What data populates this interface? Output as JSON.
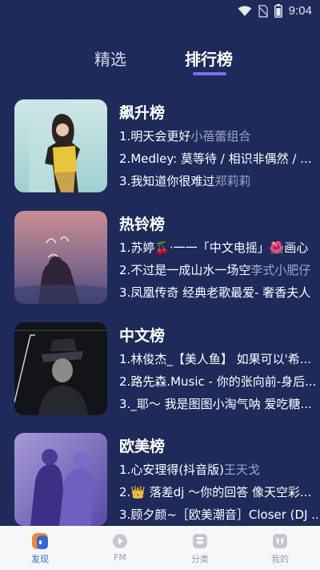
{
  "status_bar": {
    "time": "9:04"
  },
  "tabs": [
    {
      "label": "精选",
      "active": false
    },
    {
      "label": "排行榜",
      "active": true
    }
  ],
  "charts": [
    {
      "title": "飙升榜",
      "tracks": [
        {
          "num": "1.",
          "song": "明天会更好",
          "artist": "小蓓蕾组合"
        },
        {
          "num": "2.",
          "song": "Medley: 莫等待 / 相识非偶然 / ...",
          "artist": ""
        },
        {
          "num": "3.",
          "song": "我知道你很难过",
          "artist": "郑莉莉"
        }
      ]
    },
    {
      "title": "热铃榜",
      "tracks": [
        {
          "num": "1.",
          "song": "苏婷🍒·一一「中文电摇」🌺画心",
          "artist": ""
        },
        {
          "num": "2.",
          "song": "不过是一成山水一场空",
          "artist": "李式小肥仔"
        },
        {
          "num": "3.",
          "song": "凤凰传奇 经典老歌最爱- 奢香夫人",
          "artist": ""
        }
      ]
    },
    {
      "title": "中文榜",
      "tracks": [
        {
          "num": "1.",
          "song": "林俊杰_【美人鱼】 如果可以'希...",
          "artist": ""
        },
        {
          "num": "2.",
          "song": "路先森.Music - 你的张向前-身后...",
          "artist": ""
        },
        {
          "num": "3.",
          "song": "_耶～ 我是图图小淘气呐 爱吃糖...",
          "artist": ""
        }
      ]
    },
    {
      "title": "欧美榜",
      "tracks": [
        {
          "num": "1.",
          "song": "心安理得(抖音版)",
          "artist": "王天戈"
        },
        {
          "num": "2.",
          "song": "👑 落差dj ～你的回答 像天空彩...",
          "artist": ""
        },
        {
          "num": "3.",
          "song": "顾夕颜~［欧美潮音］Closer (DJ ...",
          "artist": ""
        }
      ]
    }
  ],
  "bottom_nav": [
    {
      "label": "发现",
      "icon": "discover-icon",
      "active": true
    },
    {
      "label": "FM",
      "icon": "fm-icon",
      "active": false
    },
    {
      "label": "分类",
      "icon": "category-icon",
      "active": false
    },
    {
      "label": "我的",
      "icon": "mine-icon",
      "active": false
    }
  ]
}
